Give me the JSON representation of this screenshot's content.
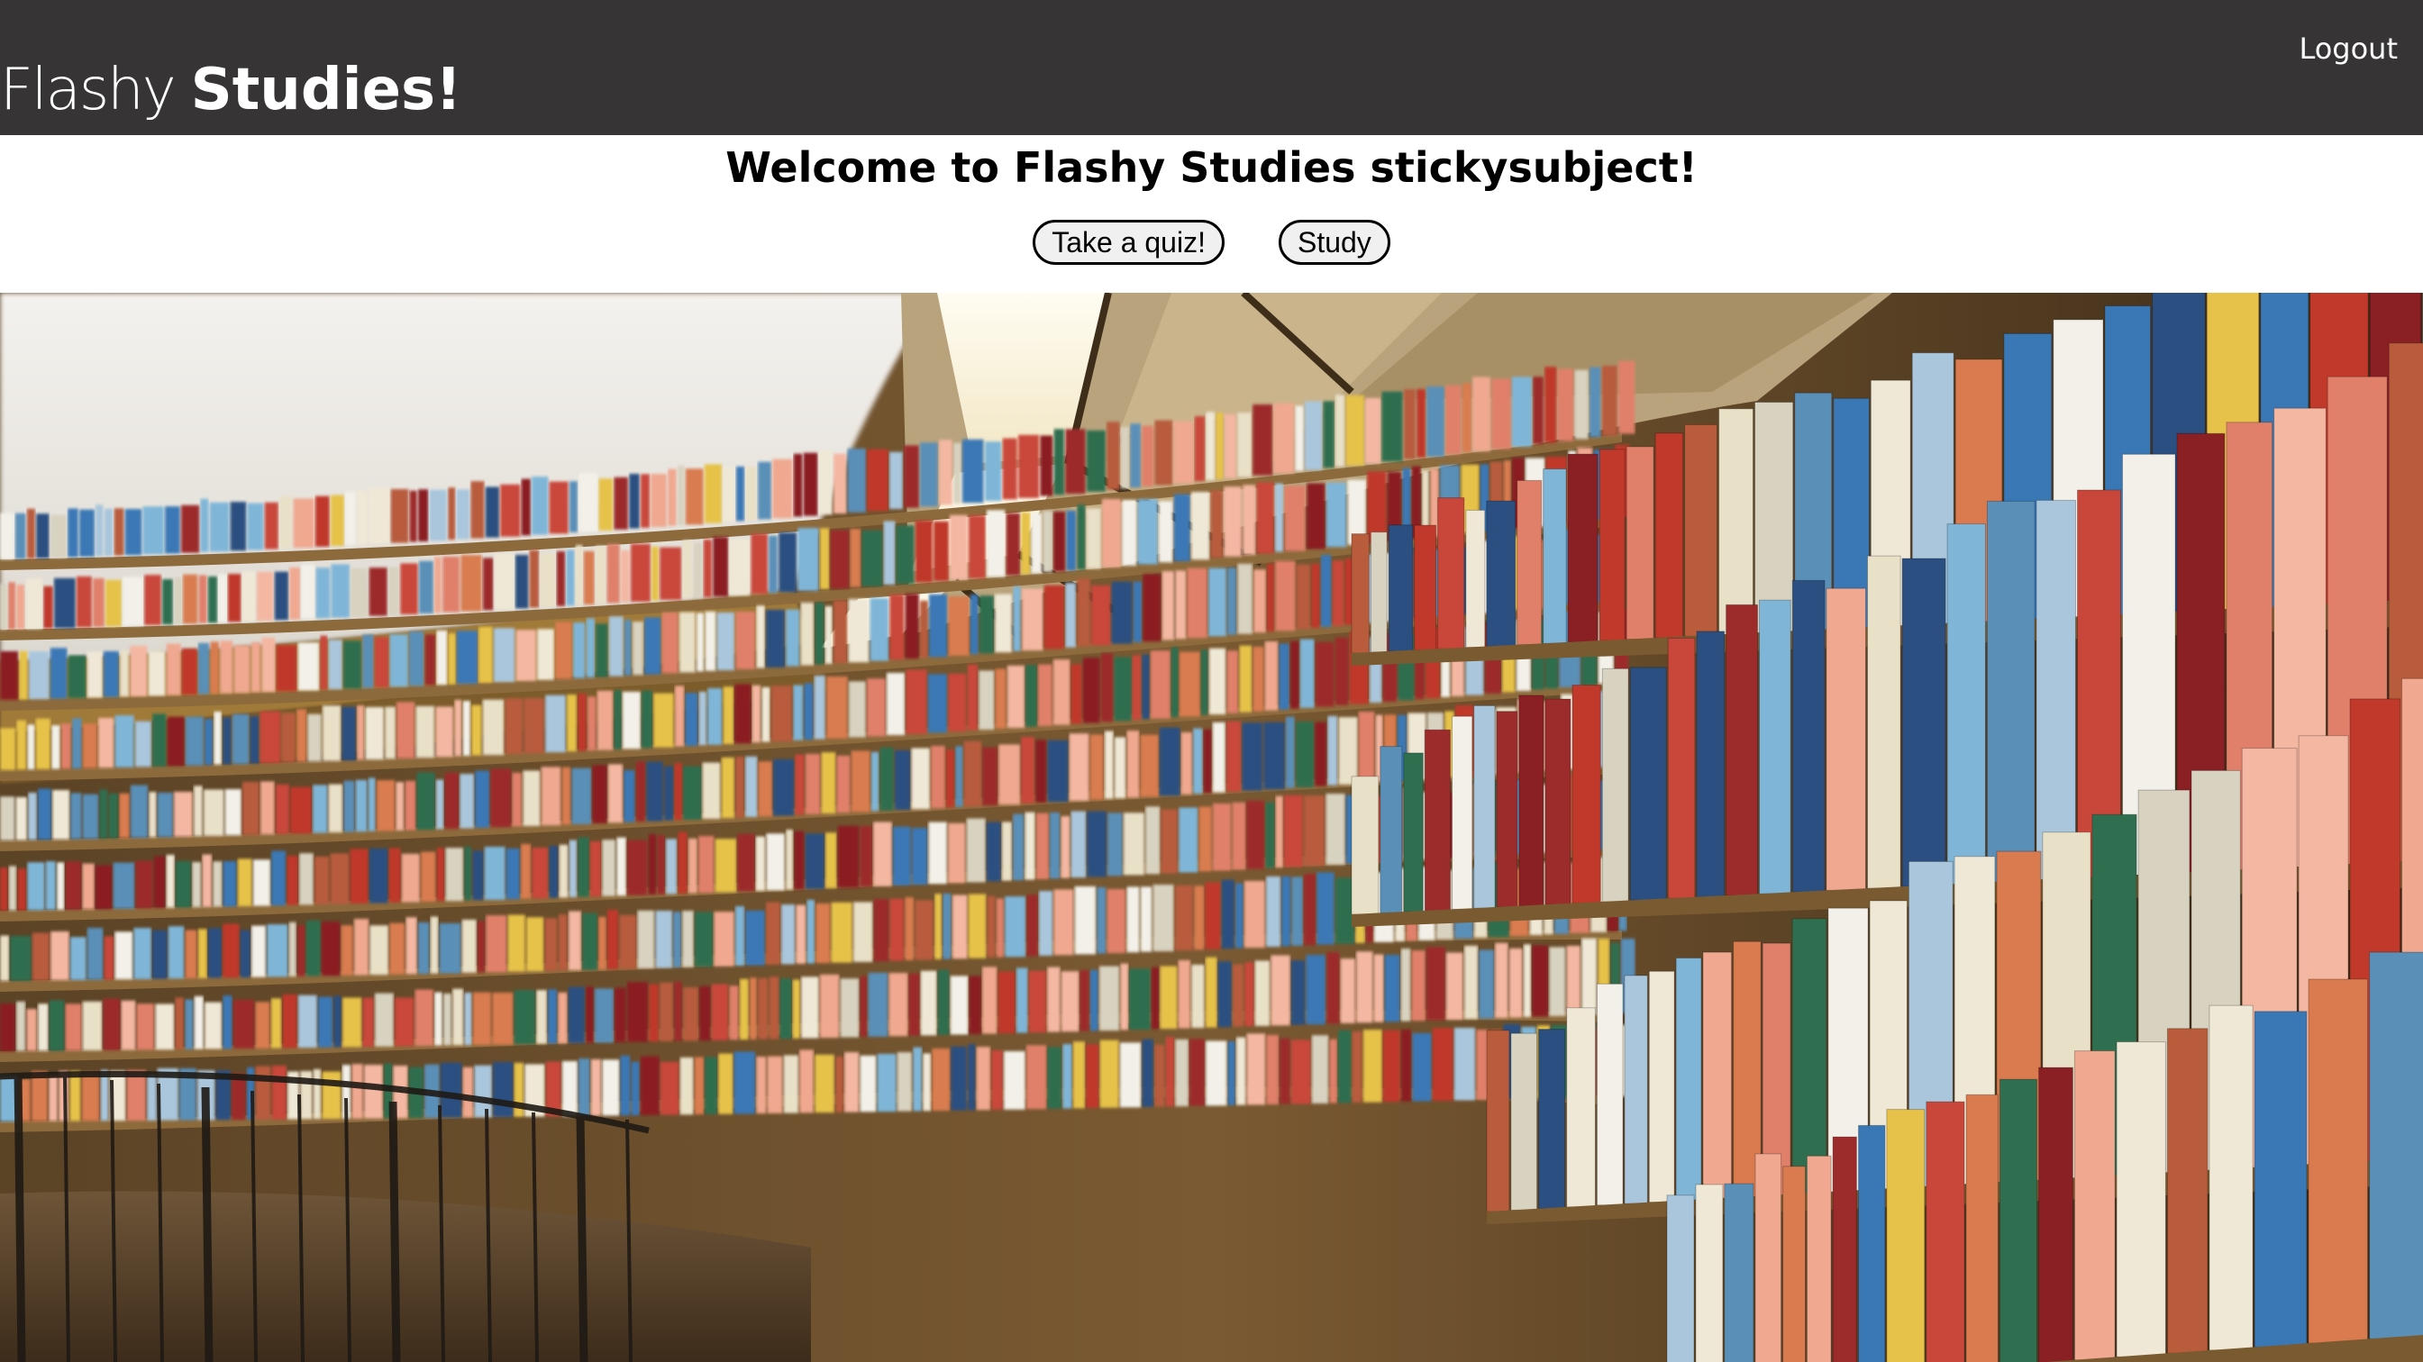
{
  "header": {
    "brand_light": "Flashy",
    "brand_bold": "Studies!",
    "logout_label": "Logout",
    "background_color": "#363435"
  },
  "welcome": {
    "title": "Welcome to Flashy Studies stickysubject!"
  },
  "actions": {
    "quiz_label": "Take a quiz!",
    "study_label": "Study"
  },
  "hero": {
    "subject": "curved library bookshelves"
  }
}
